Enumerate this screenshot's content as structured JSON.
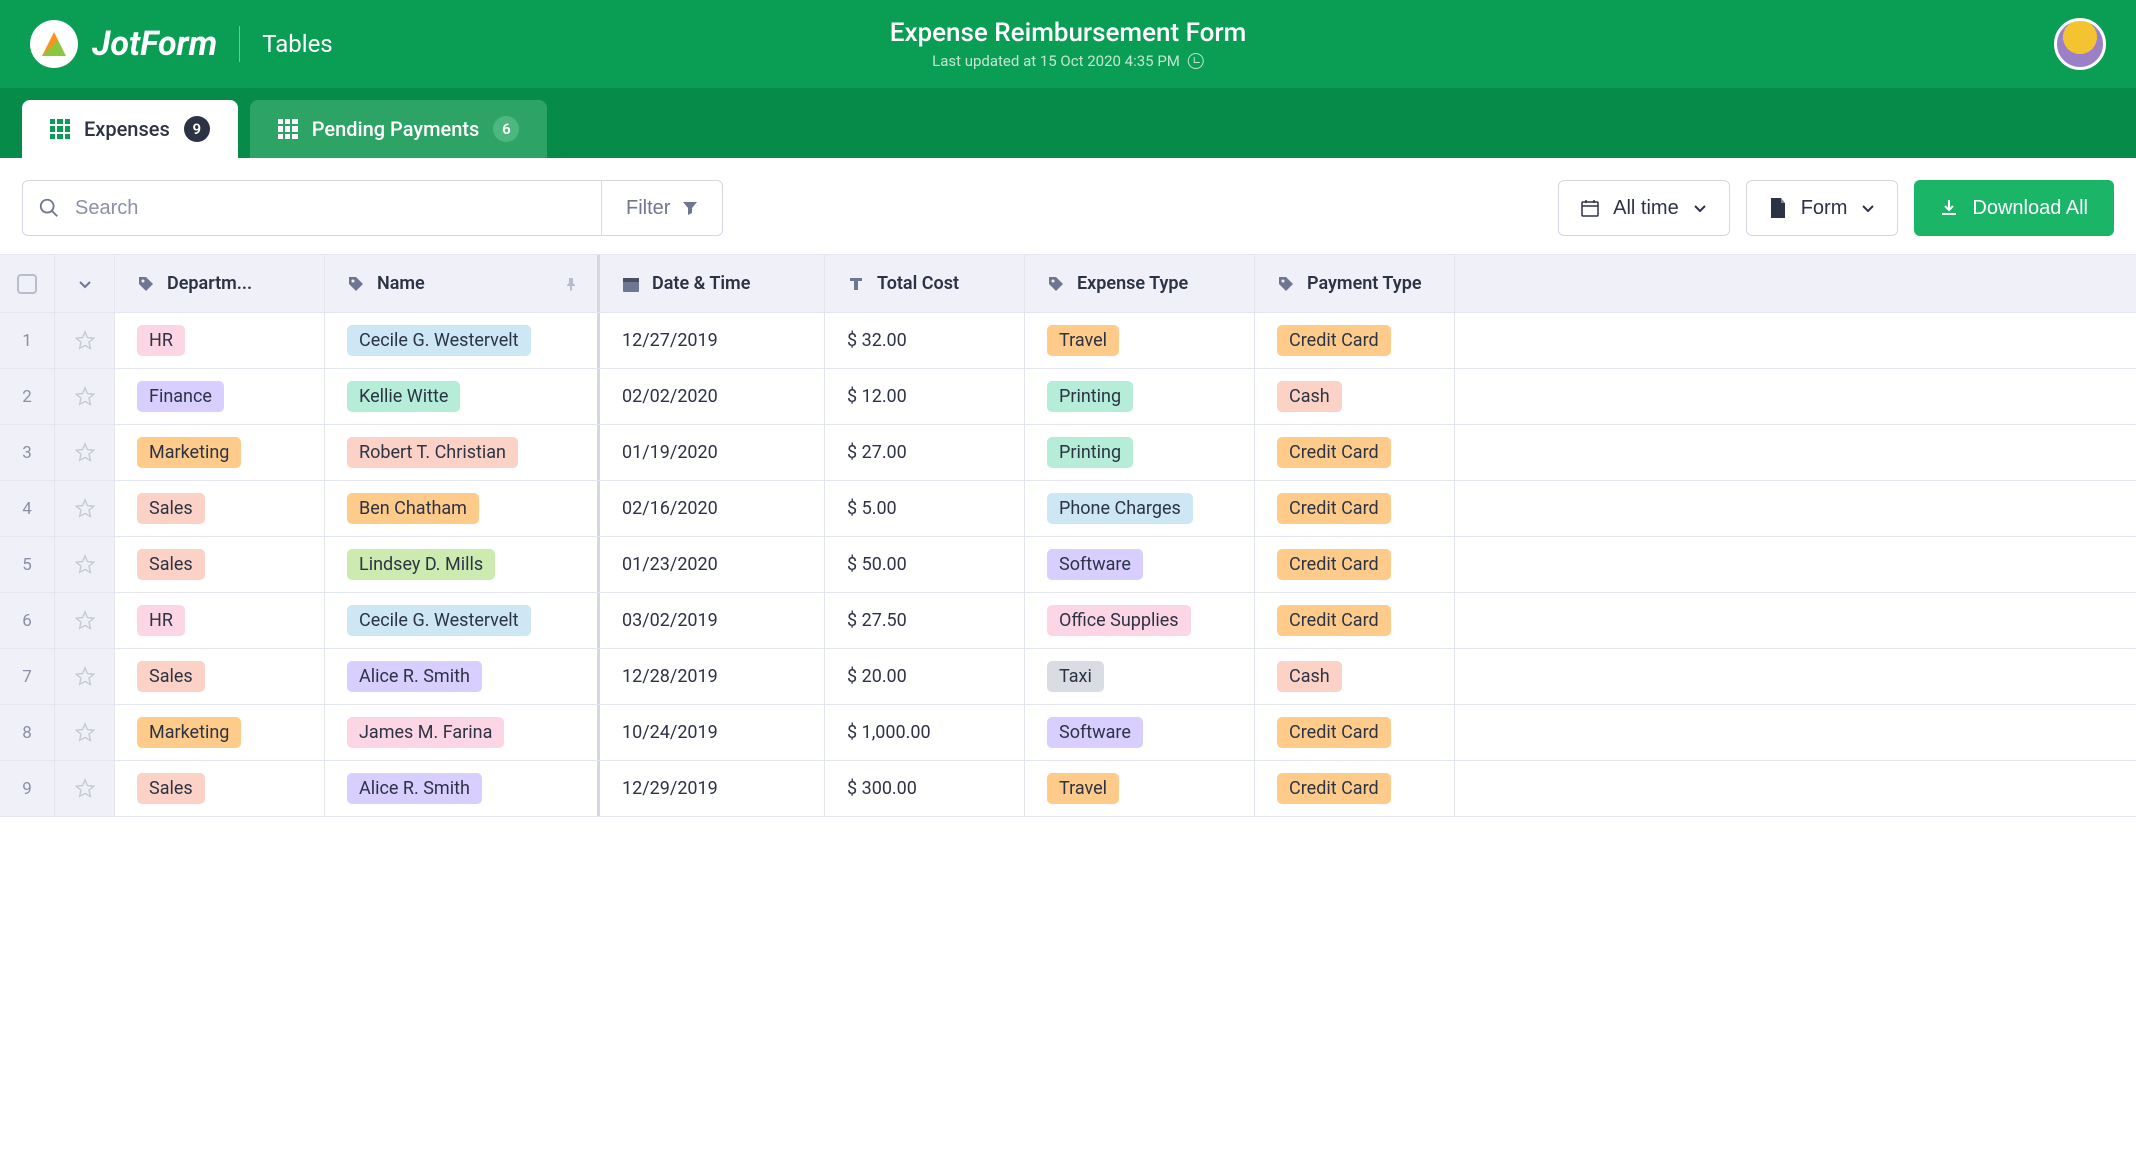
{
  "brand": {
    "name": "JotForm",
    "section": "Tables"
  },
  "page": {
    "title": "Expense Reimbursement Form",
    "subtitle": "Last updated at 15 Oct 2020 4:35 PM"
  },
  "tabs": [
    {
      "label": "Expenses",
      "count": "9",
      "active": true
    },
    {
      "label": "Pending Payments",
      "count": "6",
      "active": false
    }
  ],
  "toolbar": {
    "search_placeholder": "Search",
    "filter": "Filter",
    "time": "All time",
    "form": "Form",
    "download": "Download All"
  },
  "columns": {
    "dept": "Departm...",
    "name": "Name",
    "date": "Date & Time",
    "cost": "Total Cost",
    "etype": "Expense Type",
    "ptype": "Payment Type"
  },
  "tag_colors": {
    "HR": "#fcd6e4",
    "Finance": "#d8ceff",
    "Marketing": "#ffcb8a",
    "Sales": "#fcd2c6",
    "Cecile G. Westervelt": "#cde7f5",
    "Kellie Witte": "#b5edd8",
    "Robert T. Christian": "#fcd2c6",
    "Ben Chatham": "#ffcb8a",
    "Lindsey D. Mills": "#cdebb0",
    "Alice R. Smith": "#d8ceff",
    "James M. Farina": "#fcd6e4",
    "Travel": "#ffcb8a",
    "Printing": "#b5edd8",
    "Phone Charges": "#cde7f5",
    "Software": "#d8ceff",
    "Office Supplies": "#fcd6e4",
    "Taxi": "#d9dce3",
    "Credit Card": "#ffcb8a",
    "Cash": "#fcd2c6"
  },
  "rows": [
    {
      "dept": "HR",
      "name": "Cecile G. Westervelt",
      "date": "12/27/2019",
      "cost": "$ 32.00",
      "etype": "Travel",
      "ptype": "Credit Card"
    },
    {
      "dept": "Finance",
      "name": "Kellie Witte",
      "date": "02/02/2020",
      "cost": "$ 12.00",
      "etype": "Printing",
      "ptype": "Cash"
    },
    {
      "dept": "Marketing",
      "name": "Robert T. Christian",
      "date": "01/19/2020",
      "cost": "$ 27.00",
      "etype": "Printing",
      "ptype": "Credit Card"
    },
    {
      "dept": "Sales",
      "name": "Ben Chatham",
      "date": "02/16/2020",
      "cost": "$ 5.00",
      "etype": "Phone Charges",
      "ptype": "Credit Card"
    },
    {
      "dept": "Sales",
      "name": "Lindsey D. Mills",
      "date": "01/23/2020",
      "cost": "$ 50.00",
      "etype": "Software",
      "ptype": "Credit Card"
    },
    {
      "dept": "HR",
      "name": "Cecile G. Westervelt",
      "date": "03/02/2019",
      "cost": "$ 27.50",
      "etype": "Office Supplies",
      "ptype": "Credit Card"
    },
    {
      "dept": "Sales",
      "name": "Alice R. Smith",
      "date": "12/28/2019",
      "cost": "$ 20.00",
      "etype": "Taxi",
      "ptype": "Cash"
    },
    {
      "dept": "Marketing",
      "name": "James M. Farina",
      "date": "10/24/2019",
      "cost": "$ 1,000.00",
      "etype": "Software",
      "ptype": "Credit Card"
    },
    {
      "dept": "Sales",
      "name": "Alice R. Smith",
      "date": "12/29/2019",
      "cost": "$ 300.00",
      "etype": "Travel",
      "ptype": "Credit Card"
    }
  ]
}
